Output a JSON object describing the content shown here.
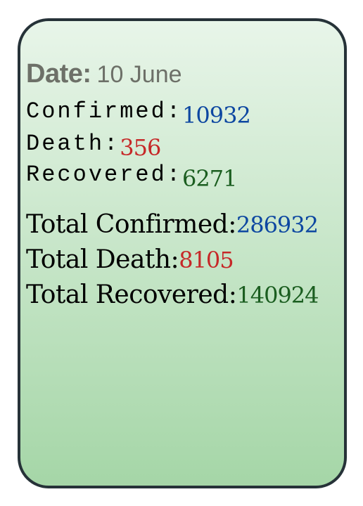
{
  "date": {
    "label": "Date:",
    "value": "10 June"
  },
  "daily": {
    "confirmed_label": "Confirmed:",
    "confirmed_value": "10932",
    "death_label": "Death:",
    "death_value": "356",
    "recovered_label": "Recovered:",
    "recovered_value": "6271"
  },
  "totals": {
    "confirmed_label": "Total Confirmed:",
    "confirmed_value": "286932",
    "death_label": "Total Death:",
    "death_value": "8105",
    "recovered_label": "Total Recovered:",
    "recovered_value": "140924"
  },
  "colors": {
    "confirmed": "#0d47a1",
    "death": "#c62828",
    "recovered": "#1b5e20",
    "date_text": "#6d7068",
    "card_border": "#263238"
  }
}
